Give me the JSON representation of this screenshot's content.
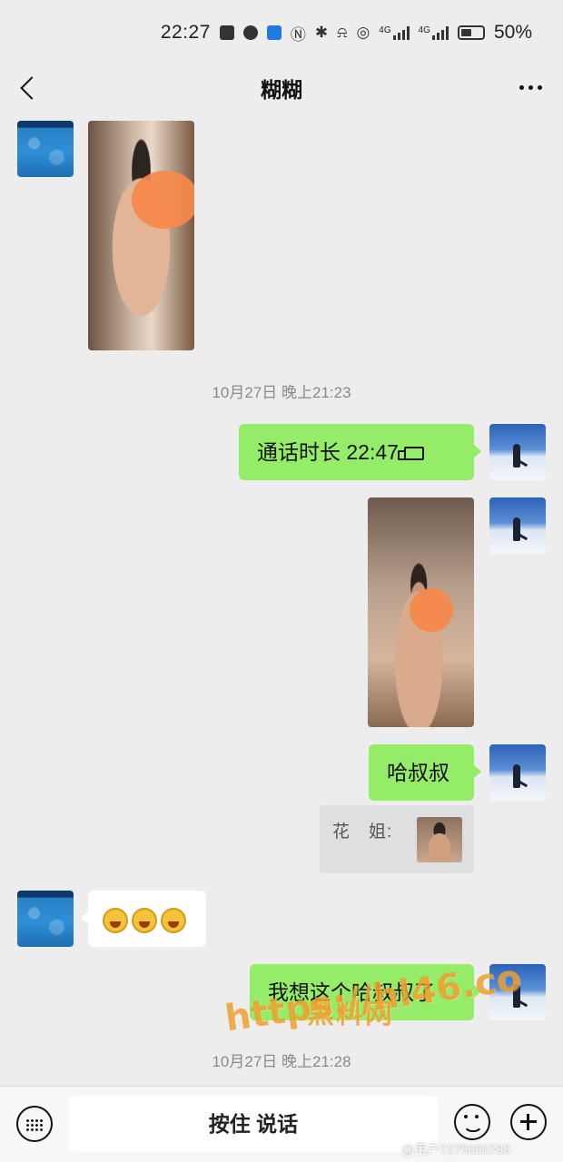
{
  "status_bar": {
    "time": "22:27",
    "network_1": "4G",
    "network_2": "4G",
    "battery_percent": "50%",
    "battery_level": 0.5
  },
  "header": {
    "title": "糊糊"
  },
  "messages": {
    "timestamp_1": "10月27日 晚上21:23",
    "call": {
      "text": "通话时长 22:47"
    },
    "text_haushushu": "哈叔叔",
    "quote": {
      "sender": "花　姐:"
    },
    "text_miss": "我想这个哈叔叔了",
    "timestamp_2": "10月27日 晚上21:28"
  },
  "input_bar": {
    "hold_to_talk": "按住 说话"
  },
  "watermark": {
    "cn": "黑料网",
    "url": "https://hl46.co",
    "weibo": "@用户7275650785"
  },
  "colors": {
    "self_bubble": "#95ec69",
    "other_bubble": "#ffffff",
    "background": "#ededed",
    "watermark": "#f0a030"
  }
}
